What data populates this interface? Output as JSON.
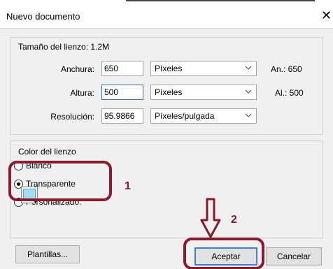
{
  "window": {
    "title": "Nuevo documento",
    "close_icon": "close-icon"
  },
  "canvas_group": {
    "label": "Tamaño del lienzo: 1.2M",
    "width": {
      "label": "Anchura:",
      "value": "650",
      "unit": "Píxeles",
      "info": "An.: 650"
    },
    "height": {
      "label": "Altura:",
      "value": "500",
      "unit": "Píxeles",
      "info": "Al.: 500"
    },
    "resolution": {
      "label": "Resolución:",
      "value": "95.9866",
      "unit": "Píxeles/pulgada"
    }
  },
  "color_group": {
    "label": "Color del lienzo",
    "options": [
      {
        "label": "Blanco",
        "checked": false
      },
      {
        "label": "Transparente",
        "checked": true
      },
      {
        "label": "Personalizado:",
        "checked": false
      }
    ],
    "custom_color": "#9fdcf6"
  },
  "buttons": {
    "templates": "Plantillas...",
    "ok": "Aceptar",
    "cancel": "Cancelar"
  },
  "annotations": {
    "step1": "1",
    "step2": "2",
    "color": "#8a1a2c"
  }
}
